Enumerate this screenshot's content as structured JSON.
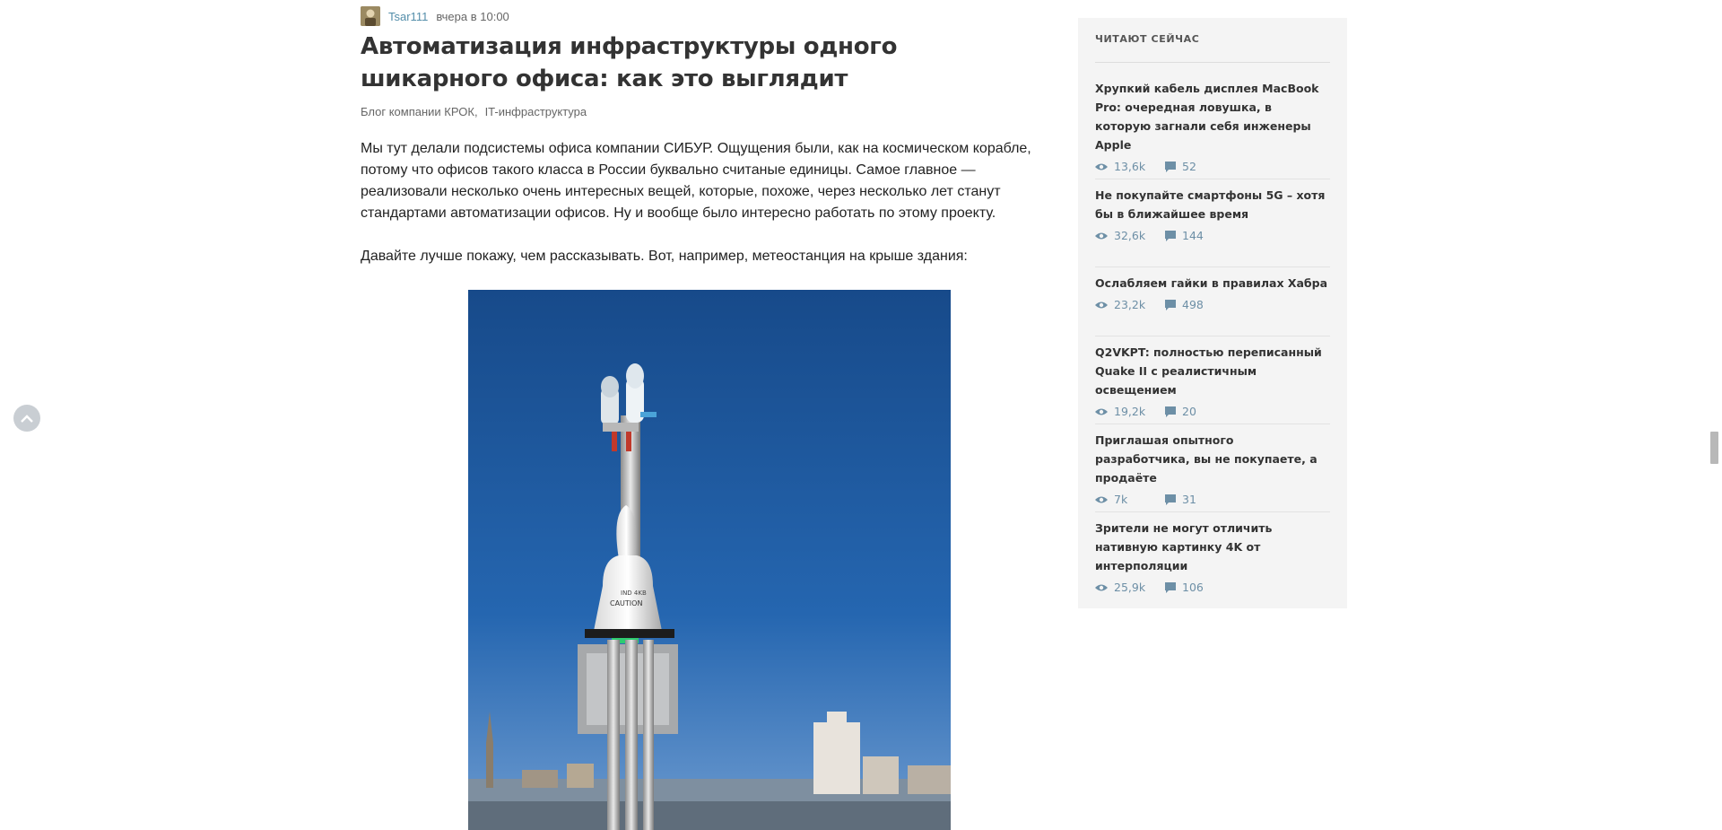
{
  "article": {
    "author": "Tsar111",
    "time": "вчера в 10:00",
    "title": "Автоматизация инфраструктуры одного шикарного офиса: как это выглядит",
    "hubs": [
      "Блог компании КРОК",
      "IT-инфраструктура"
    ],
    "hub_separator": ",",
    "paragraph1": "Мы тут делали подсистемы офиса компании СИБУР. Ощущения были, как на космическом корабле, потому что офисов такого класса в России буквально считаные единицы. Самое главное — реализовали несколько очень интересных вещей, которые, похоже, через несколько лет станут стандартами автоматизации офисов. Ну и вообще было интересно работать по этому проекту.",
    "paragraph2": "Давайте лучше покажу, чем рассказывать. Вот, например, метеостанция на крыше здания:",
    "photo_label_line1": "IND 4KB",
    "photo_label_line2": "CAUTION"
  },
  "sidebar": {
    "heading": "ЧИТАЮТ СЕЙЧАС",
    "posts": [
      {
        "title": "Хрупкий кабель дисплея MacBook Pro: очередная ловушка, в которую загнали себя инженеры Apple",
        "views": "13,6k",
        "comments": "52"
      },
      {
        "title": "Не покупайте смартфоны 5G – хотя бы в ближайшее время",
        "views": "32,6k",
        "comments": "144"
      },
      {
        "title": "Ослабляем гайки в правилах Хабра",
        "views": "23,2k",
        "comments": "498"
      },
      {
        "title": "Q2VKPT: полностью переписанный Quake II с реалистичным освещением",
        "views": "19,2k",
        "comments": "20"
      },
      {
        "title": "Приглашая опытного разработчика, вы не покупаете, а продаёте",
        "views": "7k",
        "comments": "31"
      },
      {
        "title": "Зрители не могут отличить нативную картинку 4K от интерполяции",
        "views": "25,9k",
        "comments": "106"
      }
    ]
  },
  "colors": {
    "link": "#548eaa",
    "stats": "#6d8fa6",
    "sidebar_bg": "#f4f4f4",
    "sky": "#1f5aa0"
  },
  "icons": {
    "views": "eye-icon",
    "comments": "comment-bubble-icon",
    "scroll_up": "chevron-up-icon"
  }
}
